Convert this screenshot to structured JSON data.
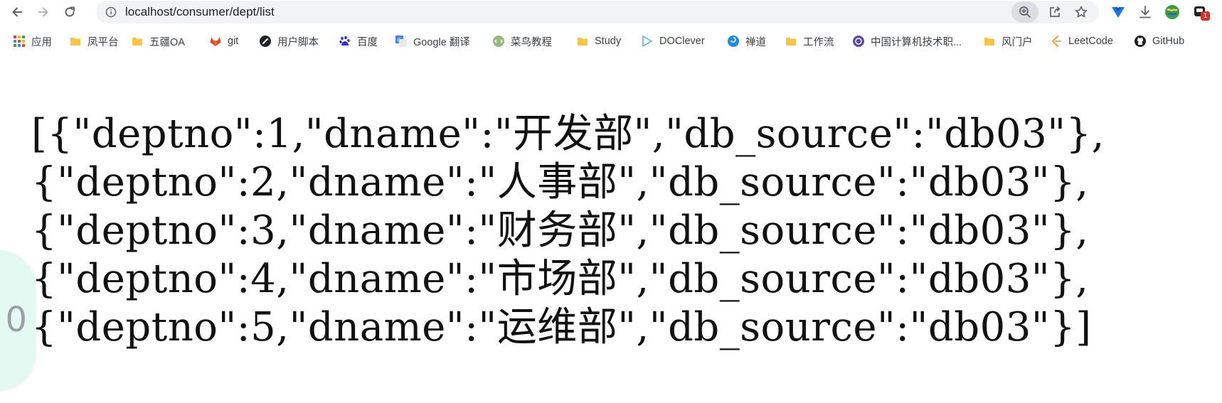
{
  "browser": {
    "url": "localhost/consumer/dept/list"
  },
  "bookmarks": [
    {
      "label": "应用",
      "icon": "apps-grid-icon"
    },
    {
      "label": "凤平台",
      "icon": "folder-icon"
    },
    {
      "label": "五疆OA",
      "icon": "folder-icon"
    },
    {
      "label": "git",
      "icon": "gitlab-icon"
    },
    {
      "label": "用户脚本",
      "icon": "userscript-icon"
    },
    {
      "label": "百度",
      "icon": "baidu-paw-icon"
    },
    {
      "label": "Google 翻译",
      "icon": "google-translate-icon"
    },
    {
      "label": "菜鸟教程",
      "icon": "runoob-icon"
    },
    {
      "label": "Study",
      "icon": "folder-icon"
    },
    {
      "label": "DOClever",
      "icon": "doclever-icon"
    },
    {
      "label": "禅道",
      "icon": "zentao-icon"
    },
    {
      "label": "工作流",
      "icon": "folder-icon"
    },
    {
      "label": "中国计算机技术职...",
      "icon": "ceac-logo-icon"
    },
    {
      "label": "风门户",
      "icon": "folder-icon"
    },
    {
      "label": "LeetCode",
      "icon": "leetcode-icon"
    },
    {
      "label": "GitHub",
      "icon": "github-icon"
    }
  ],
  "extension_badge": "1",
  "content": {
    "lines": [
      "[{\"deptno\":1,\"dname\":\"开发部\",\"db_source\":\"db03\"},",
      "{\"deptno\":2,\"dname\":\"人事部\",\"db_source\":\"db03\"},",
      "{\"deptno\":3,\"dname\":\"财务部\",\"db_source\":\"db03\"},",
      "{\"deptno\":4,\"dname\":\"市场部\",\"db_source\":\"db03\"},",
      "{\"deptno\":5,\"dname\":\"运维部\",\"db_source\":\"db03\"}]"
    ]
  },
  "side_widget_text": "0",
  "colors": {
    "folder": "#f6c542",
    "omnibox_bg": "#f1f3f4",
    "badge": "#d93025",
    "side_widget": "#e3faf2"
  }
}
